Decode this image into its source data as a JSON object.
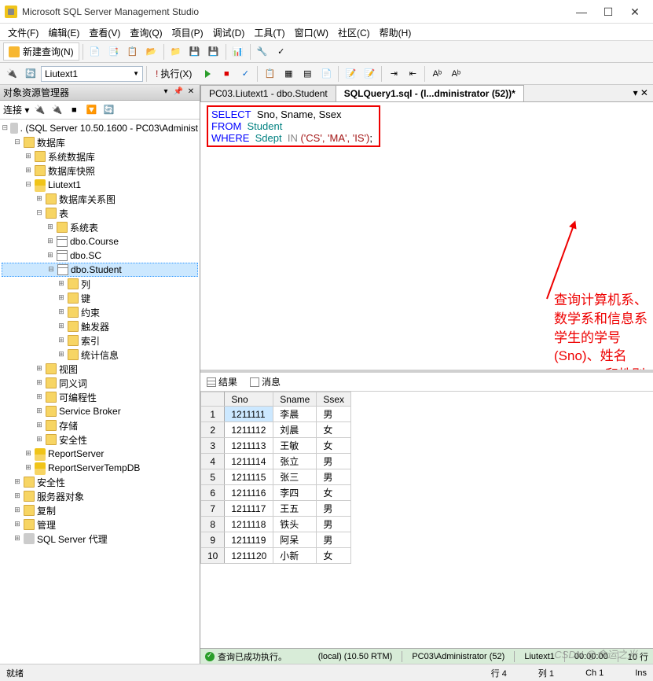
{
  "window": {
    "title": "Microsoft SQL Server Management Studio"
  },
  "menu": [
    "文件(F)",
    "编辑(E)",
    "查看(V)",
    "查询(Q)",
    "项目(P)",
    "调试(D)",
    "工具(T)",
    "窗口(W)",
    "社区(C)",
    "帮助(H)"
  ],
  "toolbar": {
    "newquery": "新建查询(N)",
    "execute": "执行(X)",
    "db": "Liutext1"
  },
  "leftpane": {
    "title": "对象资源管理器",
    "connect": "连接 ▾"
  },
  "tree": {
    "root": ". (SQL Server 10.50.1600 - PC03\\Administ",
    "databases": "数据库",
    "sysdb": "系统数据库",
    "dbsnap": "数据库快照",
    "userdb": "Liutext1",
    "dbdiag": "数据库关系图",
    "tables": "表",
    "systables": "系统表",
    "t1": "dbo.Course",
    "t2": "dbo.SC",
    "t3": "dbo.Student",
    "cols": "列",
    "keys": "键",
    "constraints": "约束",
    "triggers": "触发器",
    "indexes": "索引",
    "stats": "统计信息",
    "views": "视图",
    "synonyms": "同义词",
    "prog": "可编程性",
    "sb": "Service Broker",
    "storage": "存储",
    "security": "安全性",
    "rs": "ReportServer",
    "rstmp": "ReportServerTempDB",
    "topsec": "安全性",
    "serverobj": "服务器对象",
    "repl": "复制",
    "manage": "管理",
    "agent": "SQL Server 代理"
  },
  "tabs": {
    "t1": "PC03.Liutext1 - dbo.Student",
    "t2": "SQLQuery1.sql - (l...dministrator (52))*"
  },
  "sql": {
    "select": "SELECT",
    "from": "FROM",
    "where": "WHERE",
    "in": "IN",
    "fields": "Sno, Sname, Ssex",
    "table": "Student",
    "col": "Sdept",
    "vals": "('CS', 'MA', 'IS')",
    "semi": ";"
  },
  "annotation": {
    "l1": "查询计算机系、数学系和信息系学生的学号",
    "l2": "(Sno)、姓名(Sname)和性别(Ssex)"
  },
  "results": {
    "tab_results": "结果",
    "tab_messages": "消息",
    "cols": [
      "Sno",
      "Sname",
      "Ssex"
    ],
    "rows": [
      [
        "1211111",
        "李晨",
        "男"
      ],
      [
        "1211112",
        "刘晨",
        "女"
      ],
      [
        "1211113",
        "王敏",
        "女"
      ],
      [
        "1211114",
        "张立",
        "男"
      ],
      [
        "1211115",
        "张三",
        "男"
      ],
      [
        "1211116",
        "李四",
        "女"
      ],
      [
        "1211117",
        "王五",
        "男"
      ],
      [
        "1211118",
        "铁头",
        "男"
      ],
      [
        "1211119",
        "阿呆",
        "男"
      ],
      [
        "1211120",
        "小新",
        "女"
      ]
    ]
  },
  "status": {
    "ok": "查询已成功执行。",
    "server": "(local) (10.50 RTM)",
    "user": "PC03\\Administrator (52)",
    "db": "Liutext1",
    "time": "00:00:00",
    "rows": "10 行"
  },
  "appstatus": {
    "ready": "就绪",
    "line": "行 4",
    "col": "列 1",
    "ch": "Ch 1",
    "ins": "Ins"
  },
  "watermark": "CSDN @命运之光"
}
